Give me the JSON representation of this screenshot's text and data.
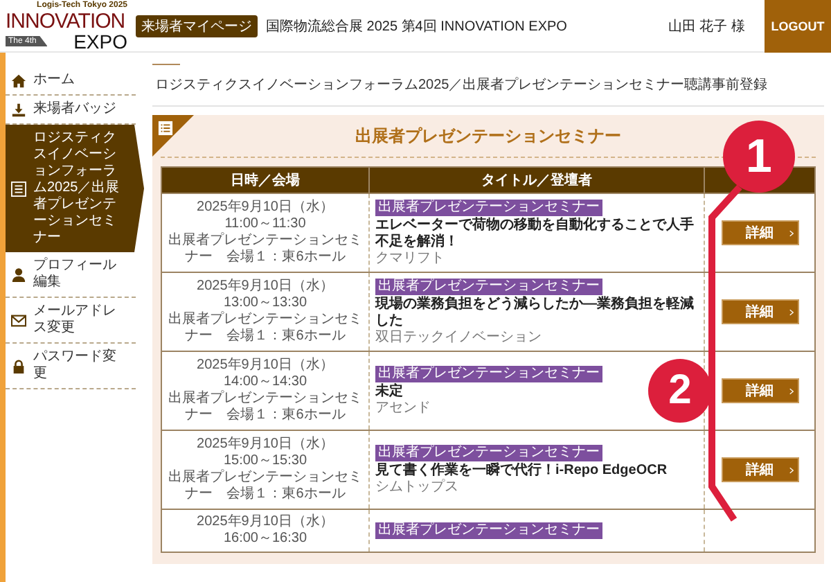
{
  "header": {
    "logo": {
      "tagline": "Logis-Tech Tokyo 2025",
      "word_1": "INNOVATION",
      "edition": "The 4th",
      "word_2": "EXPO"
    },
    "badge": "来場者マイページ",
    "title": "国際物流総合展 2025 第4回 INNOVATION EXPO",
    "user": "山田 花子 様",
    "logout": "LOGOUT"
  },
  "sidebar": {
    "items": [
      {
        "label": "ホーム",
        "kind": "home",
        "selected": false
      },
      {
        "label": "来場者バッジ",
        "kind": "download",
        "selected": false
      },
      {
        "label": "ロジスティクスイノベーションフォーラム2025／出展者プレゼンテーションセミナー",
        "kind": "list",
        "selected": true
      },
      {
        "label": "プロフィール編集",
        "kind": "person",
        "selected": false
      },
      {
        "label": "メールアドレス変更",
        "kind": "mail",
        "selected": false
      },
      {
        "label": "パスワード変更",
        "kind": "lock",
        "selected": false
      }
    ]
  },
  "page_title": "ロジスティクスイノベーションフォーラム2025／出展者プレゼンテーションセミナー聴講事前登録",
  "card": {
    "title": "出展者プレゼンテーションセミナー",
    "table": {
      "columns": [
        "日時／会場",
        "タイトル／登壇者"
      ],
      "rows": [
        {
          "date": "2025年9月10日（水）",
          "time": "11:00～11:30",
          "venue": "出展者プレゼンテーションセミナー　会場１：東6ホール",
          "tag": "出展者プレゼンテーションセミナー",
          "title": "エレベーターで荷物の移動を自動化することで人手不足を解消！",
          "speaker": "クマリフト",
          "action": "詳細"
        },
        {
          "date": "2025年9月10日（水）",
          "time": "13:00～13:30",
          "venue": "出展者プレゼンテーションセミナー　会場１：東6ホール",
          "tag": "出展者プレゼンテーションセミナー",
          "title": "現場の業務負担をどう減らしたか―業務負担を軽減した",
          "speaker": "双日テックイノベーション",
          "action": "詳細"
        },
        {
          "date": "2025年9月10日（水）",
          "time": "14:00～14:30",
          "venue": "出展者プレゼンテーションセミナー　会場１：東6ホール",
          "tag": "出展者プレゼンテーションセミナー",
          "title": "未定",
          "speaker": "アセンド",
          "action": "詳細"
        },
        {
          "date": "2025年9月10日（水）",
          "time": "15:00～15:30",
          "venue": "出展者プレゼンテーションセミナー　会場１：東6ホール",
          "tag": "出展者プレゼンテーションセミナー",
          "title": "見て書く作業を一瞬で代行！i-Repo EdgeOCR",
          "speaker": "シムトップス",
          "action": "詳細"
        },
        {
          "date": "2025年9月10日（水）",
          "time": "16:00～16:30",
          "tag": "出展者プレゼンテーションセミナー"
        }
      ]
    }
  },
  "annotations": [
    {
      "label": "1"
    },
    {
      "label": "2"
    }
  ]
}
